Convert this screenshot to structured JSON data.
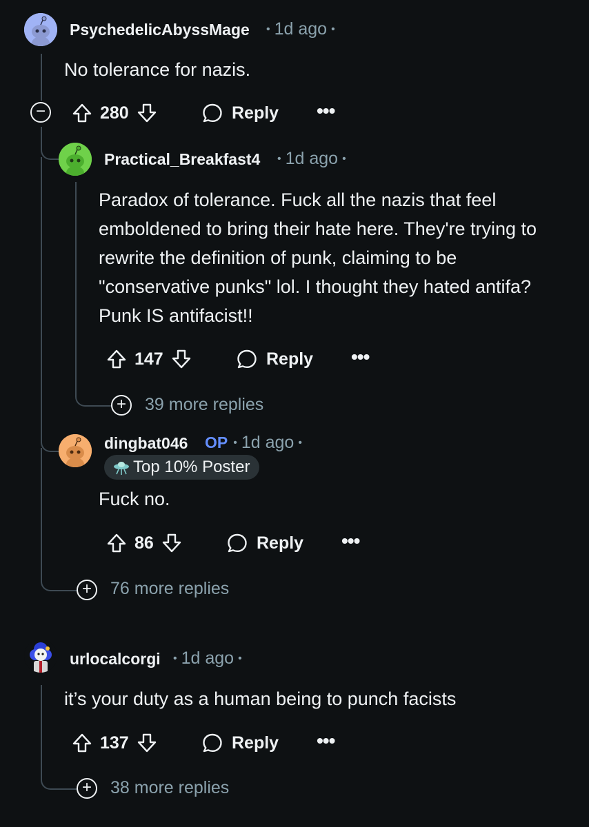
{
  "comments": [
    {
      "username": "PsychedelicAbyssMage",
      "time": "1d ago",
      "body": "No tolerance for nazis.",
      "votes": "280",
      "reply_label": "Reply",
      "avatar_color": "#a0b3f5"
    },
    {
      "username": "Practical_Breakfast4",
      "time": "1d ago",
      "body": "Paradox of tolerance. Fuck all the nazis that feel emboldened to bring their hate here. They're trying to rewrite the definition of punk, claiming to be \"conservative punks\" lol. I thought they hated antifa? Punk IS antifacist!!",
      "votes": "147",
      "reply_label": "Reply",
      "more_replies": "39 more replies",
      "avatar_color": "#5ecb3c"
    },
    {
      "username": "dingbat046",
      "op_label": "OP",
      "time": "1d ago",
      "badge": "Top 10% Poster",
      "body": "Fuck no.",
      "votes": "86",
      "reply_label": "Reply",
      "avatar_color": "#f5a563"
    },
    {
      "username": "urlocalcorgi",
      "time": "1d ago",
      "body": "it’s your duty as a human being to punch facists",
      "votes": "137",
      "reply_label": "Reply",
      "more_replies": "38 more replies"
    }
  ],
  "thread_more_replies": "76 more replies",
  "colors": {
    "background": "#0e1113",
    "text": "#eef1f3",
    "meta": "#8ba2ad",
    "op": "#648efc",
    "thread_line": "#3e4a53"
  }
}
